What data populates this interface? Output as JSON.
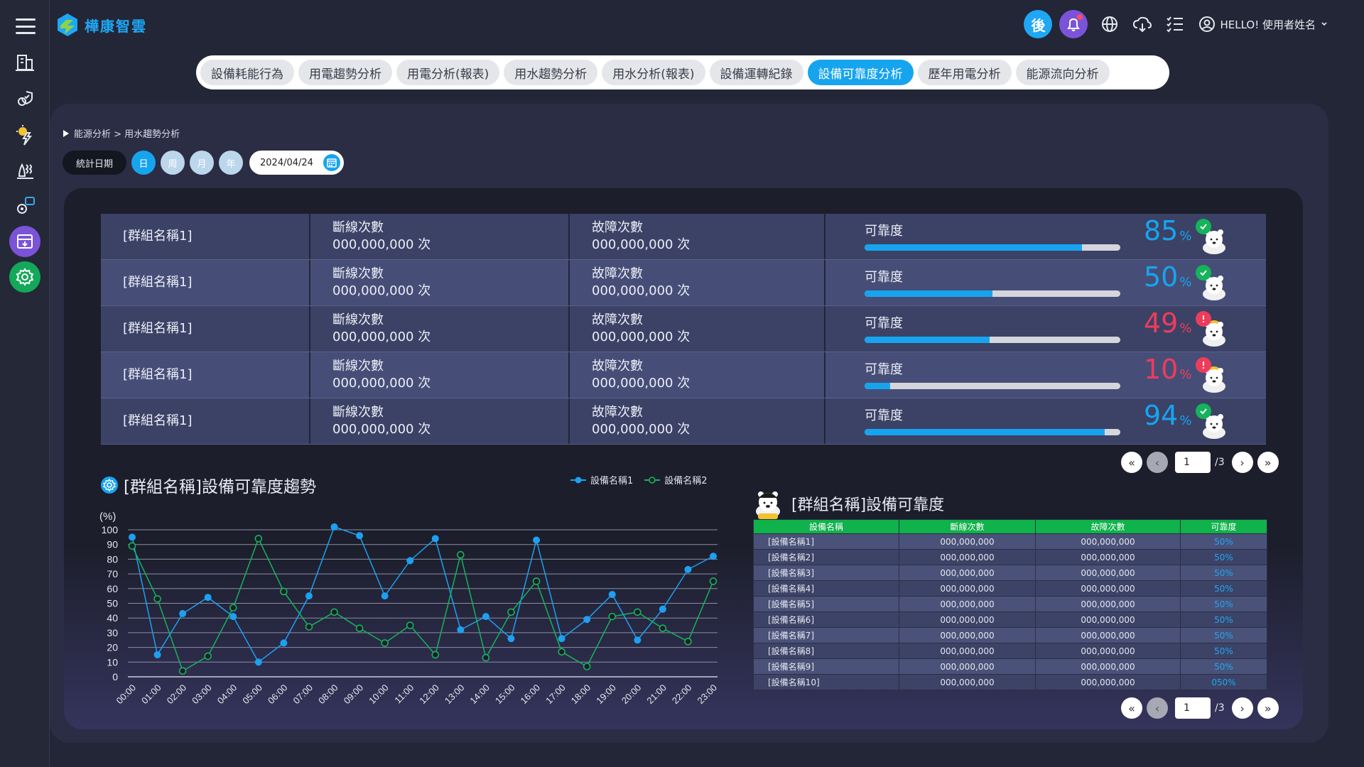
{
  "app": {
    "brand": "樺康智雲",
    "badge_text": "後",
    "user_greeting": "HELLO! 使用者姓名"
  },
  "tabs": [
    "設備耗能行為",
    "用電趨勢分析",
    "用電分析(報表)",
    "用水趨勢分析",
    "用水分析(報表)",
    "設備運轉紀錄",
    "設備可靠度分析",
    "歷年用電分析",
    "能源流向分析"
  ],
  "active_tab": 6,
  "breadcrumb": "能源分析 > 用水趨勢分析",
  "filter": {
    "label": "統計日期",
    "day": "日",
    "week": "周",
    "month": "月",
    "year": "年",
    "date": "2024/04/24"
  },
  "groups": {
    "col_disconnect": "斷線次數",
    "col_fault": "故障次數",
    "col_reliability": "可靠度",
    "unit": "次",
    "pct_unit": "%",
    "rows": [
      {
        "name": "[群組名稱1]",
        "disconnect": "000,000,000",
        "fault": "000,000,000",
        "reliability": 85,
        "status": "ok"
      },
      {
        "name": "[群組名稱1]",
        "disconnect": "000,000,000",
        "fault": "000,000,000",
        "reliability": 50,
        "status": "ok"
      },
      {
        "name": "[群組名稱1]",
        "disconnect": "000,000,000",
        "fault": "000,000,000",
        "reliability": 49,
        "status": "warn"
      },
      {
        "name": "[群組名稱1]",
        "disconnect": "000,000,000",
        "fault": "000,000,000",
        "reliability": 10,
        "status": "warn"
      },
      {
        "name": "[群組名稱1]",
        "disconnect": "000,000,000",
        "fault": "000,000,000",
        "reliability": 94,
        "status": "ok"
      }
    ]
  },
  "pager_top": {
    "page": "1",
    "total": "/3"
  },
  "pager_bottom": {
    "page": "1",
    "total": "/3"
  },
  "trend": {
    "title": "[群組名稱]設備可靠度趨勢",
    "yunit": "(%)"
  },
  "chart_data": {
    "type": "line",
    "title": "[群組名稱]設備可靠度趨勢",
    "ylabel": "(%)",
    "ylim": [
      0,
      100
    ],
    "yticks": [
      0,
      10,
      20,
      30,
      40,
      50,
      60,
      70,
      80,
      90,
      100
    ],
    "x": [
      "00:00",
      "01:00",
      "02:00",
      "03:00",
      "04:00",
      "05:00",
      "06:00",
      "07:00",
      "08:00",
      "09:00",
      "10:00",
      "11:00",
      "12:00",
      "13:00",
      "14:00",
      "15:00",
      "16:00",
      "17:00",
      "18:00",
      "19:00",
      "20:00",
      "21:00",
      "22:00",
      "23:00"
    ],
    "series": [
      {
        "name": "設備名稱1",
        "color": "#1ea0f0",
        "values": [
          95,
          15,
          43,
          54,
          41,
          10,
          23,
          55,
          102,
          96,
          55,
          79,
          94,
          32,
          41,
          26,
          93,
          26,
          39,
          56,
          25,
          46,
          73,
          82
        ]
      },
      {
        "name": "設備名稱2",
        "color": "#16b35c",
        "values": [
          89,
          53,
          4,
          14,
          47,
          94,
          58,
          34,
          44,
          33,
          23,
          35,
          15,
          83,
          13,
          44,
          65,
          17,
          7,
          41,
          44,
          33,
          24,
          65
        ]
      }
    ],
    "legend": "top-right",
    "grid": true
  },
  "devices": {
    "title": "[群組名稱]設備可靠度",
    "headers": [
      "設備名稱",
      "斷線次數",
      "故障次數",
      "可靠度"
    ],
    "rows": [
      [
        "[設備名稱1]",
        "000,000,000",
        "000,000,000",
        "50%"
      ],
      [
        "[設備名稱2]",
        "000,000,000",
        "000,000,000",
        "50%"
      ],
      [
        "[設備名稱3]",
        "000,000,000",
        "000,000,000",
        "50%"
      ],
      [
        "[設備名稱4]",
        "000,000,000",
        "000,000,000",
        "50%"
      ],
      [
        "[設備名稱5]",
        "000,000,000",
        "000,000,000",
        "50%"
      ],
      [
        "[設備名稱6]",
        "000,000,000",
        "000,000,000",
        "50%"
      ],
      [
        "[設備名稱7]",
        "000,000,000",
        "000,000,000",
        "50%"
      ],
      [
        "[設備名稱8]",
        "000,000,000",
        "000,000,000",
        "50%"
      ],
      [
        "[設備名稱9]",
        "000,000,000",
        "000,000,000",
        "50%"
      ],
      [
        "[設備名稱10]",
        "000,000,000",
        "000,000,000",
        "050%"
      ]
    ]
  },
  "colors": {
    "accent": "#17a4ef",
    "ok": "#14b45a",
    "warn": "#ee3c5c",
    "purple": "#7b53d8",
    "green_btn": "#14a85a"
  },
  "icons": [
    "menu-icon",
    "building-icon",
    "shield-gear-icon",
    "bulb-bolt-icon",
    "water-heat-icon",
    "device-report-icon",
    "report-export-icon",
    "settings-icon",
    "globe-icon",
    "cloud-download-icon",
    "list-icon",
    "user-icon",
    "bell-icon",
    "calendar-icon"
  ]
}
